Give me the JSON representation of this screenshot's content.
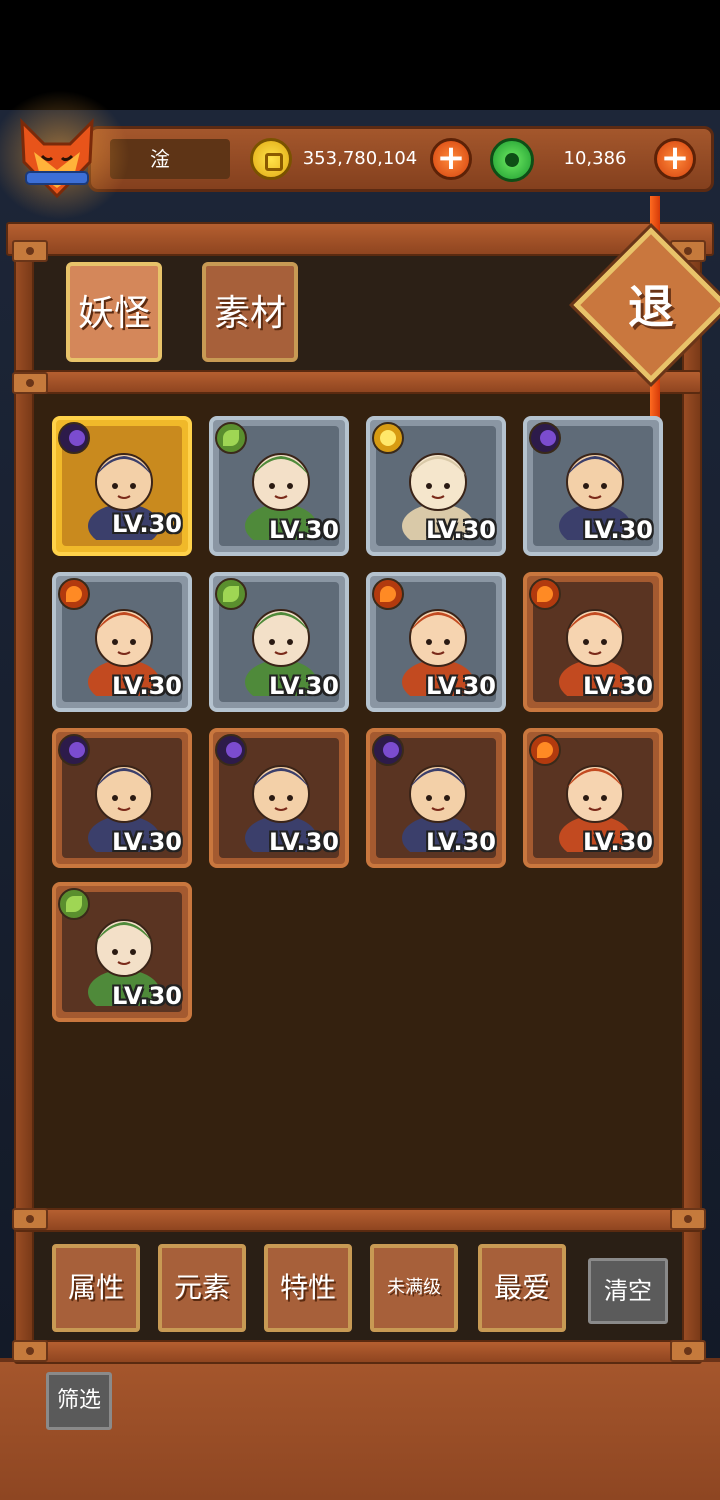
{
  "player": {
    "name": "淦",
    "avatar_icon": "fox-mask-icon"
  },
  "currency": {
    "gold": "353,780,104",
    "gold_icon": "gold-coin-icon",
    "jade": "10,386",
    "jade_icon": "jade-coin-icon",
    "add_icon": "plus-icon"
  },
  "tabs": [
    {
      "label": "妖怪",
      "active": true
    },
    {
      "label": "素材",
      "active": false
    }
  ],
  "exit_label": "退",
  "heroes": [
    {
      "level": "LV.30",
      "element": "dark",
      "frame": "gold"
    },
    {
      "level": "LV.30",
      "element": "wood",
      "frame": "silver"
    },
    {
      "level": "LV.30",
      "element": "light",
      "frame": "silver"
    },
    {
      "level": "LV.30",
      "element": "dark",
      "frame": "silver"
    },
    {
      "level": "LV.30",
      "element": "fire",
      "frame": "silver"
    },
    {
      "level": "LV.30",
      "element": "wood",
      "frame": "silver"
    },
    {
      "level": "LV.30",
      "element": "fire",
      "frame": "silver"
    },
    {
      "level": "LV.30",
      "element": "fire",
      "frame": "bronze"
    },
    {
      "level": "LV.30",
      "element": "dark",
      "frame": "bronze"
    },
    {
      "level": "LV.30",
      "element": "dark",
      "frame": "bronze"
    },
    {
      "level": "LV.30",
      "element": "dark",
      "frame": "bronze"
    },
    {
      "level": "LV.30",
      "element": "fire",
      "frame": "bronze"
    },
    {
      "level": "LV.30",
      "element": "wood",
      "frame": "bronze"
    }
  ],
  "filters": [
    "属性",
    "元素",
    "特性",
    "未满级",
    "最爱"
  ],
  "clear_label": "清空",
  "filter_label": "筛选",
  "colors": {
    "wood_frame": "#a4572c",
    "panel_bg": "#34210f",
    "gold_frame": "#ffd24a",
    "silver_frame": "#b5c3cf",
    "bronze_frame": "#c9773e",
    "exit_rope": "#ff6a20"
  }
}
